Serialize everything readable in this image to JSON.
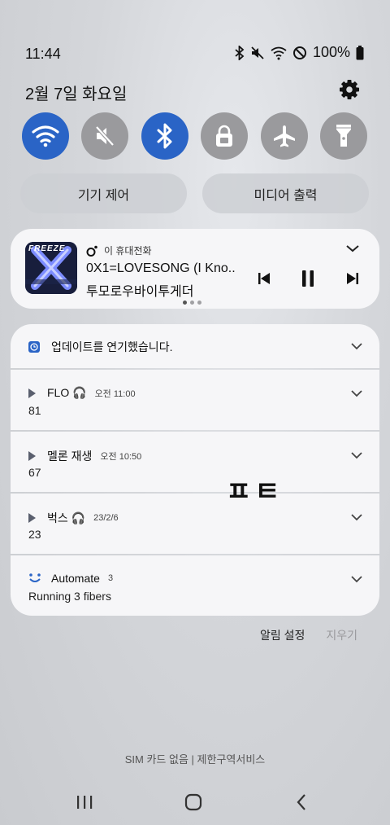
{
  "status_bar": {
    "time": "11:44",
    "battery_text": "100%",
    "icons": [
      "bluetooth-icon",
      "mute-icon",
      "wifi-icon",
      "do-not-disturb-icon",
      "battery-icon"
    ]
  },
  "header": {
    "date": "2월 7일 화요일"
  },
  "quick_toggles": [
    {
      "name": "wifi",
      "state": "on"
    },
    {
      "name": "sound-muted",
      "state": "off"
    },
    {
      "name": "bluetooth",
      "state": "on"
    },
    {
      "name": "screen-lock",
      "state": "off"
    },
    {
      "name": "airplane-mode",
      "state": "off"
    },
    {
      "name": "flashlight",
      "state": "off"
    }
  ],
  "pills": {
    "device_control": "기기 제어",
    "media_output": "미디어 출력"
  },
  "media": {
    "source": "이 휴대전화",
    "title": "0X1=LOVESONG (I Kno...",
    "artist": "투모로우바이투게더",
    "album_art_text": "FREEZE",
    "page_indicator": {
      "count": 3,
      "active": 1
    }
  },
  "notifications": [
    {
      "app": "업데이트를 연기했습니다.",
      "time": "",
      "body": ""
    },
    {
      "app": "FLO 🎧",
      "time": "오전 11:00",
      "body": "81"
    },
    {
      "app": "멜론 재생",
      "time": "오전 10:50",
      "body": "67"
    },
    {
      "app": "벅스 🎧",
      "time": "23/2/6",
      "body": "23"
    },
    {
      "app": "Automate",
      "time": "3",
      "body": "Running 3 fibers"
    }
  ],
  "overlay_text": "ㅍㅌ",
  "footer": {
    "notif_settings": "알림 설정",
    "clear": "지우기",
    "sim": "SIM 카드 없음 | 제한구역서비스"
  },
  "colors": {
    "toggle_on": "#2a64c6",
    "toggle_off": "#9a9a9d",
    "card_bg": "#f6f6f8"
  }
}
